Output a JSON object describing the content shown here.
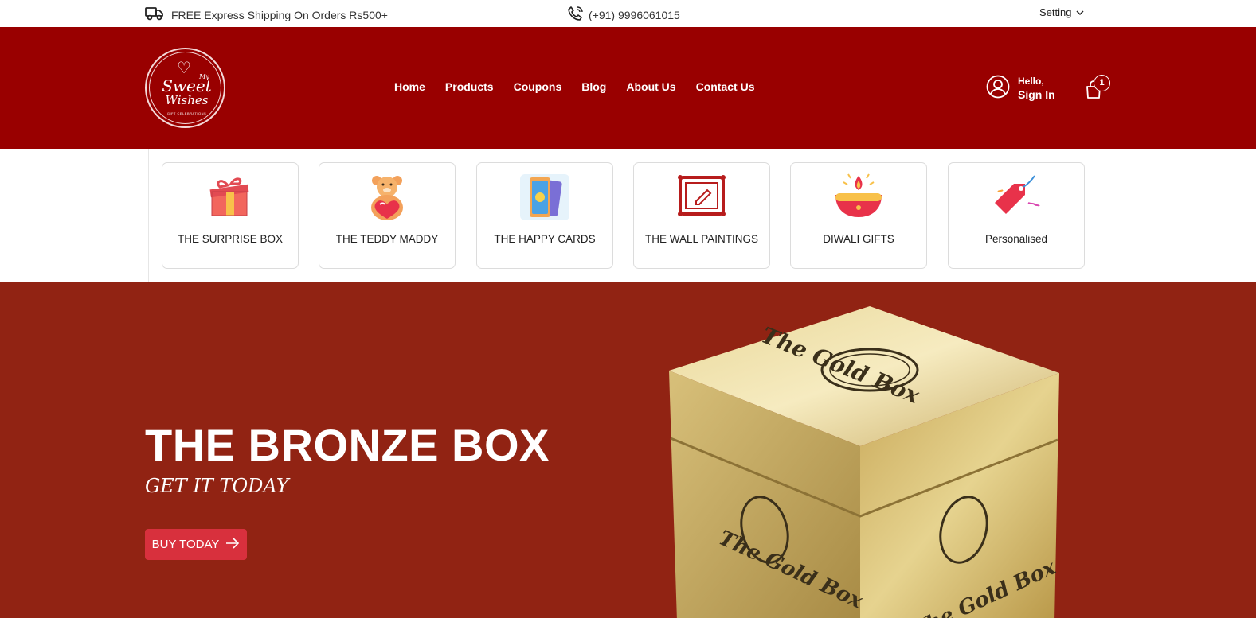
{
  "topbar": {
    "shipping_text": "FREE Express Shipping On Orders Rs500+",
    "phone_text": "(+91) 9996061015",
    "setting_label": "Setting"
  },
  "header": {
    "logo": {
      "top_text": "My",
      "main_text": "Sweet",
      "sub_text": "Wishes",
      "tagline": "GIFT CELEBRATIONS"
    },
    "nav": [
      {
        "label": "Home"
      },
      {
        "label": "Products"
      },
      {
        "label": "Coupons"
      },
      {
        "label": "Blog"
      },
      {
        "label": "About Us"
      },
      {
        "label": "Contact Us"
      }
    ],
    "account": {
      "greeting": "Hello,",
      "action": "Sign In"
    },
    "cart_count": "1"
  },
  "categories": [
    {
      "label": "THE SURPRISE BOX",
      "icon": "gift-box-icon"
    },
    {
      "label": "THE TEDDY MADDY",
      "icon": "teddy-bear-icon"
    },
    {
      "label": "THE HAPPY CARDS",
      "icon": "cards-icon"
    },
    {
      "label": "THE WALL PAINTINGS",
      "icon": "painting-frame-icon"
    },
    {
      "label": "DIWALI GIFTS",
      "icon": "diya-lamp-icon"
    },
    {
      "label": "Personalised",
      "icon": "gift-tag-icon"
    }
  ],
  "hero": {
    "title": "THE BRONZE BOX",
    "subtitle": "GET IT TODAY",
    "button_label": "BUY TODAY",
    "box_lid_text": "The Gold Box",
    "box_front_text": "The Gold Box",
    "box_side_text": "The Gold Box"
  },
  "colors": {
    "header_bg": "#990000",
    "hero_bg": "#912313",
    "button_bg": "#d8303d"
  }
}
